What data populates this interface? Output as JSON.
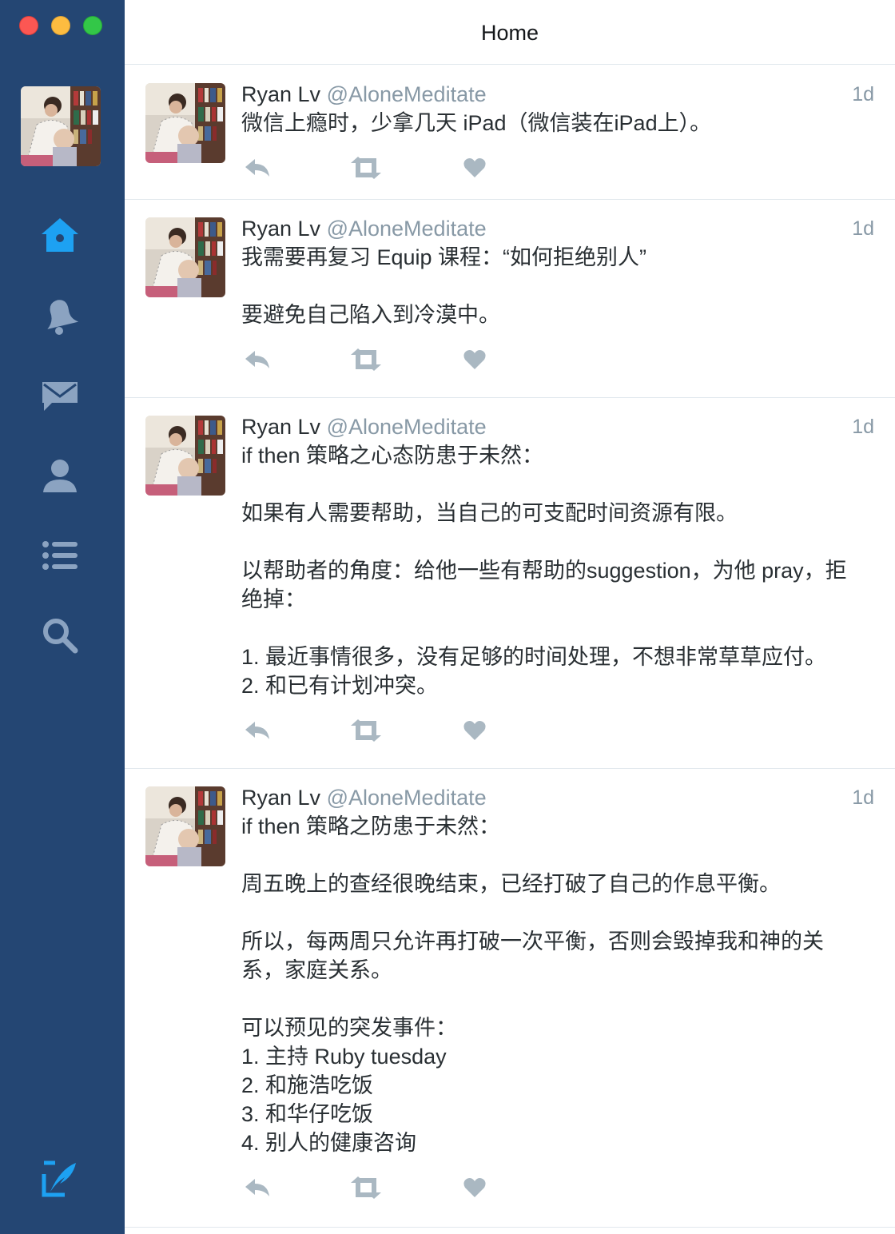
{
  "window": {
    "title": "Home",
    "controls": [
      "close",
      "minimize",
      "maximize"
    ]
  },
  "colors": {
    "sidebar_bg": "#244673",
    "nav_active": "#1da1f2",
    "nav_inactive": "#8ba3c1",
    "action_icon": "#aab8c2",
    "handle": "#8899a6",
    "text": "#292f33"
  },
  "sidebar": {
    "account_avatar": "profile-photo",
    "items": [
      {
        "icon": "home-icon",
        "active": true
      },
      {
        "icon": "bell-icon",
        "active": false
      },
      {
        "icon": "envelope-icon",
        "active": false
      },
      {
        "icon": "user-icon",
        "active": false
      },
      {
        "icon": "list-icon",
        "active": false
      },
      {
        "icon": "search-icon",
        "active": false
      }
    ],
    "compose_icon": "compose-icon"
  },
  "timeline": [
    {
      "name": "Ryan Lv",
      "handle": "@AloneMeditate",
      "time": "1d",
      "lines": [
        "微信上瘾时，少拿几天 iPad（微信装在iPad上）。"
      ]
    },
    {
      "name": "Ryan Lv",
      "handle": "@AloneMeditate",
      "time": "1d",
      "lines": [
        "我需要再复习 Equip 课程：“如何拒绝别人”",
        "",
        "要避免自己陷入到冷漠中。"
      ]
    },
    {
      "name": "Ryan Lv",
      "handle": "@AloneMeditate",
      "time": "1d",
      "lines": [
        "if then 策略之心态防患于未然：",
        "",
        "如果有人需要帮助，当自己的可支配时间资源有限。",
        "",
        "以帮助者的角度：给他一些有帮助的suggestion，为他 pray，拒",
        "绝掉：",
        "",
        "1. 最近事情很多，没有足够的时间处理，不想非常草草应付。",
        "2. 和已有计划冲突。"
      ]
    },
    {
      "name": "Ryan Lv",
      "handle": "@AloneMeditate",
      "time": "1d",
      "lines": [
        "if then 策略之防患于未然：",
        "",
        "周五晚上的查经很晚结束，已经打破了自己的作息平衡。",
        "",
        "所以，每两周只允许再打破一次平衡，否则会毁掉我和神的关",
        "系，家庭关系。",
        "",
        "可以预见的突发事件：",
        "1. 主持 Ruby tuesday",
        "2. 和施浩吃饭",
        "3. 和华仔吃饭",
        "4. 别人的健康咨询"
      ]
    }
  ]
}
